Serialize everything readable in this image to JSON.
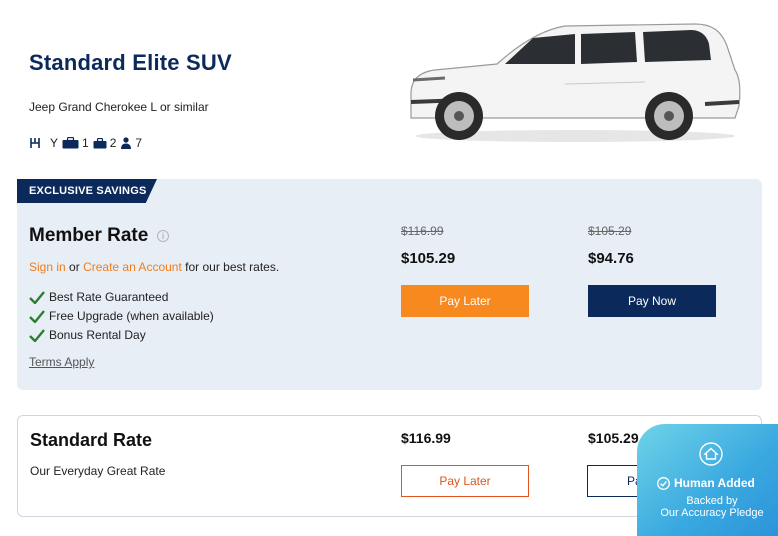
{
  "vehicle": {
    "title": "Standard Elite SUV",
    "subtitle": "Jeep Grand Cherokee L or similar",
    "features": {
      "transmission_value": "Y",
      "large_bags": "1",
      "small_bags": "2",
      "passengers": "7"
    }
  },
  "member": {
    "ribbon": "EXCLUSIVE SAVINGS",
    "title": "Member Rate",
    "signin_link": "Sign in",
    "or_text": "or",
    "create_link": "Create an Account",
    "signin_suffix": "for our best rates.",
    "benefits": [
      "Best Rate Guaranteed",
      "Free Upgrade (when available)",
      "Bonus Rental Day"
    ],
    "terms": "Terms Apply",
    "pay_later": {
      "old_price": "$116.99",
      "price": "$105.29",
      "button": "Pay Later"
    },
    "pay_now": {
      "old_price": "$105.29",
      "price": "$94.76",
      "button": "Pay Now"
    }
  },
  "standard": {
    "title": "Standard Rate",
    "subtitle": "Our Everyday Great Rate",
    "pay_later": {
      "price": "$116.99",
      "button": "Pay Later"
    },
    "pay_now": {
      "price": "$105.29",
      "button": "Pay Now"
    }
  },
  "badge": {
    "title": "Human Added",
    "line1": "Backed by",
    "line2": "Our Accuracy Pledge"
  },
  "colors": {
    "navy": "#0b2a5b",
    "orange": "#f7891f",
    "card_bg": "#e8eef5",
    "badge": "#3aa9e0"
  }
}
